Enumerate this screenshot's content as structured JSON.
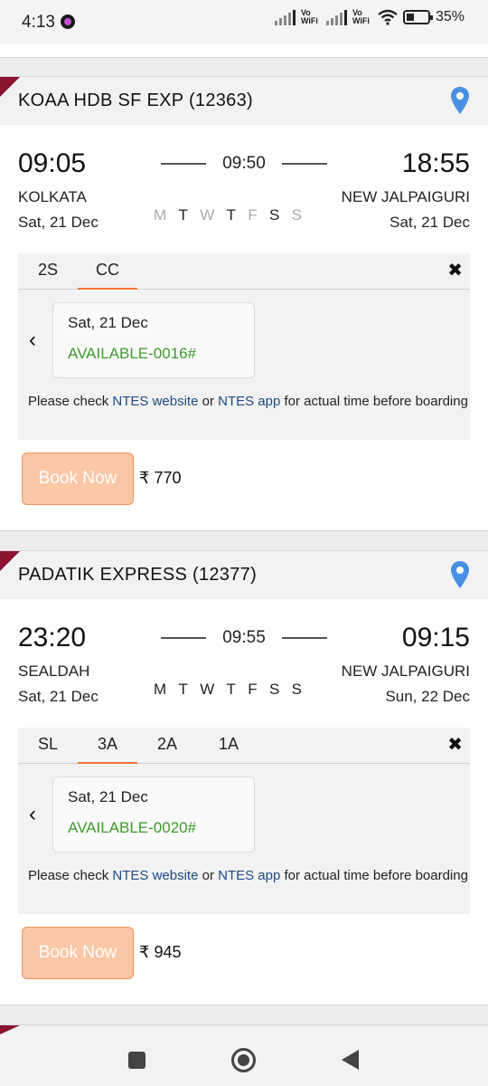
{
  "status_bar": {
    "time": "4:13",
    "network_1": "Vo WiFi",
    "network_2": "Vo WiFi",
    "battery_percent": "35%",
    "battery_level": 0.35
  },
  "trains": [
    {
      "name": "KOAA HDB SF EXP (12363)",
      "departure_time": "09:05",
      "duration": "09:50",
      "arrival_time": "18:55",
      "from_station": "KOLKATA",
      "to_station": "NEW JALPAIGURI",
      "from_date": "Sat, 21 Dec",
      "to_date": "Sat, 21 Dec",
      "days": [
        {
          "label": "M",
          "runs": false
        },
        {
          "label": "T",
          "runs": true
        },
        {
          "label": "W",
          "runs": false
        },
        {
          "label": "T",
          "runs": true
        },
        {
          "label": "F",
          "runs": false
        },
        {
          "label": "S",
          "runs": true
        },
        {
          "label": "S",
          "runs": false
        }
      ],
      "classes": [
        "2S",
        "CC"
      ],
      "active_class": "CC",
      "availability_date": "Sat, 21 Dec",
      "availability_status": "AVAILABLE-0016#",
      "book_label": "Book Now",
      "price": "₹ 770"
    },
    {
      "name": "PADATIK EXPRESS (12377)",
      "departure_time": "23:20",
      "duration": "09:55",
      "arrival_time": "09:15",
      "from_station": "SEALDAH",
      "to_station": "NEW JALPAIGURI",
      "from_date": "Sat, 21 Dec",
      "to_date": "Sun, 22 Dec",
      "days": [
        {
          "label": "M",
          "runs": true
        },
        {
          "label": "T",
          "runs": true
        },
        {
          "label": "W",
          "runs": true
        },
        {
          "label": "T",
          "runs": true
        },
        {
          "label": "F",
          "runs": true
        },
        {
          "label": "S",
          "runs": true
        },
        {
          "label": "S",
          "runs": true
        }
      ],
      "classes": [
        "SL",
        "3A",
        "2A",
        "1A"
      ],
      "active_class": "3A",
      "availability_date": "Sat, 21 Dec",
      "availability_status": "AVAILABLE-0020#",
      "book_label": "Book Now",
      "price": "₹ 945"
    }
  ],
  "note": {
    "prefix": "Please check",
    "link1": "NTES website",
    "middle": "or",
    "link2": "NTES app",
    "suffix": "for actual time before boarding"
  },
  "close_symbol": "✖",
  "prev_symbol": "‹",
  "colors": {
    "accent_orange": "#f0773a",
    "book_button_bg": "#fbc7a6",
    "available_green": "#3e9a2b",
    "link_blue": "#1d4a86",
    "corner_maroon": "#8a1330",
    "pin_blue": "#4a90e2"
  },
  "icons": {
    "location": "location-pin-icon",
    "close": "close-icon",
    "prev": "chevron-left-icon"
  }
}
